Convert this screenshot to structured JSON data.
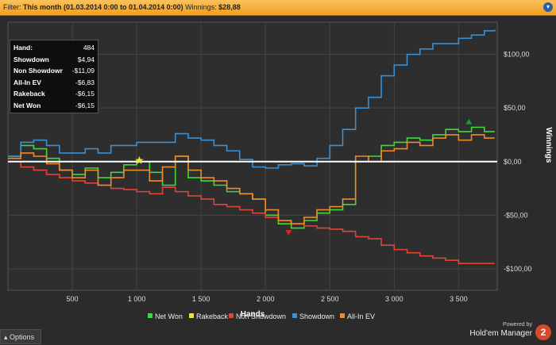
{
  "filter": {
    "label": "Filter:",
    "value": "This month (01.03.2014 0:00 to 01.04.2014 0:00)",
    "winnings_label": "Winnings:",
    "winnings": "$28,88",
    "toggle_icon": "chevron-down-icon"
  },
  "stats": [
    {
      "label": "Hand:",
      "value": "484"
    },
    {
      "label": "Showdown",
      "value": "$4,94"
    },
    {
      "label": "Non Showdown",
      "value": "-$11,09"
    },
    {
      "label": "All-In EV",
      "value": "-$6,83"
    },
    {
      "label": "Rakeback",
      "value": "-$6,15"
    },
    {
      "label": "Net Won",
      "value": "-$6,15"
    }
  ],
  "bottom": {
    "options_label": "Options",
    "powered_by": "Powered by",
    "brand": "Hold'em Manager",
    "logo_text": "2"
  },
  "chart_data": {
    "type": "line",
    "xlabel": "Hands",
    "ylabel": "Winnings",
    "xlim": [
      0,
      3800
    ],
    "ylim": [
      -120,
      130
    ],
    "x_ticks": [
      500,
      1000,
      1500,
      2000,
      2500,
      3000,
      3500
    ],
    "x_tick_labels": [
      "500",
      "1 000",
      "1 500",
      "2 000",
      "2 500",
      "3 000",
      "3 500"
    ],
    "y_ticks": [
      100,
      50,
      0,
      -50,
      -100
    ],
    "y_tick_labels": [
      "$100,00",
      "$50,00",
      "$0,00",
      "-$50,00",
      "-$100,00"
    ],
    "grid": true,
    "legend_position": "bottom-right",
    "zero_line": true,
    "series": [
      {
        "name": "Net Won",
        "color": "#3ddc35",
        "x": [
          0,
          100,
          200,
          300,
          400,
          500,
          600,
          700,
          800,
          900,
          1000,
          1100,
          1200,
          1300,
          1400,
          1500,
          1600,
          1700,
          1800,
          1900,
          2000,
          2100,
          2200,
          2300,
          2400,
          2500,
          2600,
          2700,
          2800,
          2900,
          3000,
          3100,
          3200,
          3300,
          3400,
          3500,
          3600,
          3700,
          3780
        ],
        "y": [
          5,
          15,
          12,
          3,
          -8,
          -12,
          -6,
          -15,
          -10,
          -3,
          0,
          -10,
          -22,
          5,
          -15,
          -18,
          -22,
          -28,
          -30,
          -35,
          -50,
          -58,
          -62,
          -55,
          -48,
          -45,
          -40,
          0,
          5,
          15,
          18,
          22,
          20,
          25,
          30,
          28,
          32,
          28,
          28
        ]
      },
      {
        "name": "Rakeback",
        "color": "#f0e030",
        "x": [
          0,
          3780
        ],
        "y": [
          0,
          0
        ]
      },
      {
        "name": "Non Showdown",
        "color": "#e04535",
        "x": [
          0,
          100,
          200,
          300,
          400,
          500,
          600,
          700,
          800,
          900,
          1000,
          1100,
          1200,
          1300,
          1400,
          1500,
          1600,
          1700,
          1800,
          1900,
          2000,
          2100,
          2200,
          2300,
          2400,
          2500,
          2600,
          2700,
          2800,
          2900,
          3000,
          3100,
          3200,
          3300,
          3400,
          3500,
          3600,
          3700,
          3780
        ],
        "y": [
          0,
          -5,
          -8,
          -12,
          -15,
          -18,
          -20,
          -22,
          -25,
          -26,
          -28,
          -30,
          -24,
          -28,
          -32,
          -35,
          -40,
          -42,
          -45,
          -48,
          -52,
          -55,
          -58,
          -60,
          -62,
          -63,
          -65,
          -70,
          -72,
          -78,
          -82,
          -85,
          -88,
          -90,
          -92,
          -95,
          -95,
          -95,
          -95
        ]
      },
      {
        "name": "Showdown",
        "color": "#3c8fd0",
        "x": [
          0,
          100,
          200,
          300,
          400,
          500,
          600,
          700,
          800,
          900,
          1000,
          1100,
          1200,
          1300,
          1400,
          1500,
          1600,
          1700,
          1800,
          1900,
          2000,
          2100,
          2200,
          2300,
          2400,
          2500,
          2600,
          2700,
          2800,
          2900,
          3000,
          3100,
          3200,
          3300,
          3400,
          3500,
          3600,
          3700,
          3780
        ],
        "y": [
          5,
          18,
          20,
          15,
          8,
          8,
          12,
          8,
          15,
          15,
          18,
          18,
          18,
          26,
          22,
          20,
          15,
          10,
          2,
          -5,
          -6,
          -3,
          -2,
          -4,
          3,
          15,
          30,
          50,
          60,
          80,
          90,
          100,
          105,
          110,
          110,
          115,
          118,
          122,
          123
        ]
      },
      {
        "name": "All-In EV",
        "color": "#f08a2a",
        "x": [
          0,
          100,
          200,
          300,
          400,
          500,
          600,
          700,
          800,
          900,
          1000,
          1100,
          1200,
          1300,
          1400,
          1500,
          1600,
          1700,
          1800,
          1900,
          2000,
          2100,
          2200,
          2300,
          2400,
          2500,
          2600,
          2700,
          2800,
          2900,
          3000,
          3100,
          3200,
          3300,
          3400,
          3500,
          3600,
          3700,
          3780
        ],
        "y": [
          3,
          8,
          5,
          -2,
          -8,
          -15,
          -8,
          -22,
          -15,
          -8,
          -8,
          -18,
          -5,
          5,
          -8,
          -15,
          -18,
          -25,
          -30,
          -35,
          -45,
          -55,
          -58,
          -52,
          -45,
          -42,
          -35,
          5,
          0,
          10,
          12,
          18,
          15,
          22,
          25,
          20,
          25,
          22,
          22
        ]
      }
    ],
    "markers": [
      {
        "shape": "star",
        "x": 1020,
        "y": 1,
        "color": "#f0e030"
      },
      {
        "shape": "triangle-down",
        "x": 2180,
        "y": -66,
        "color": "#e02020"
      },
      {
        "shape": "triangle-up",
        "x": 3580,
        "y": 37,
        "color": "#1a9a2a"
      }
    ]
  }
}
